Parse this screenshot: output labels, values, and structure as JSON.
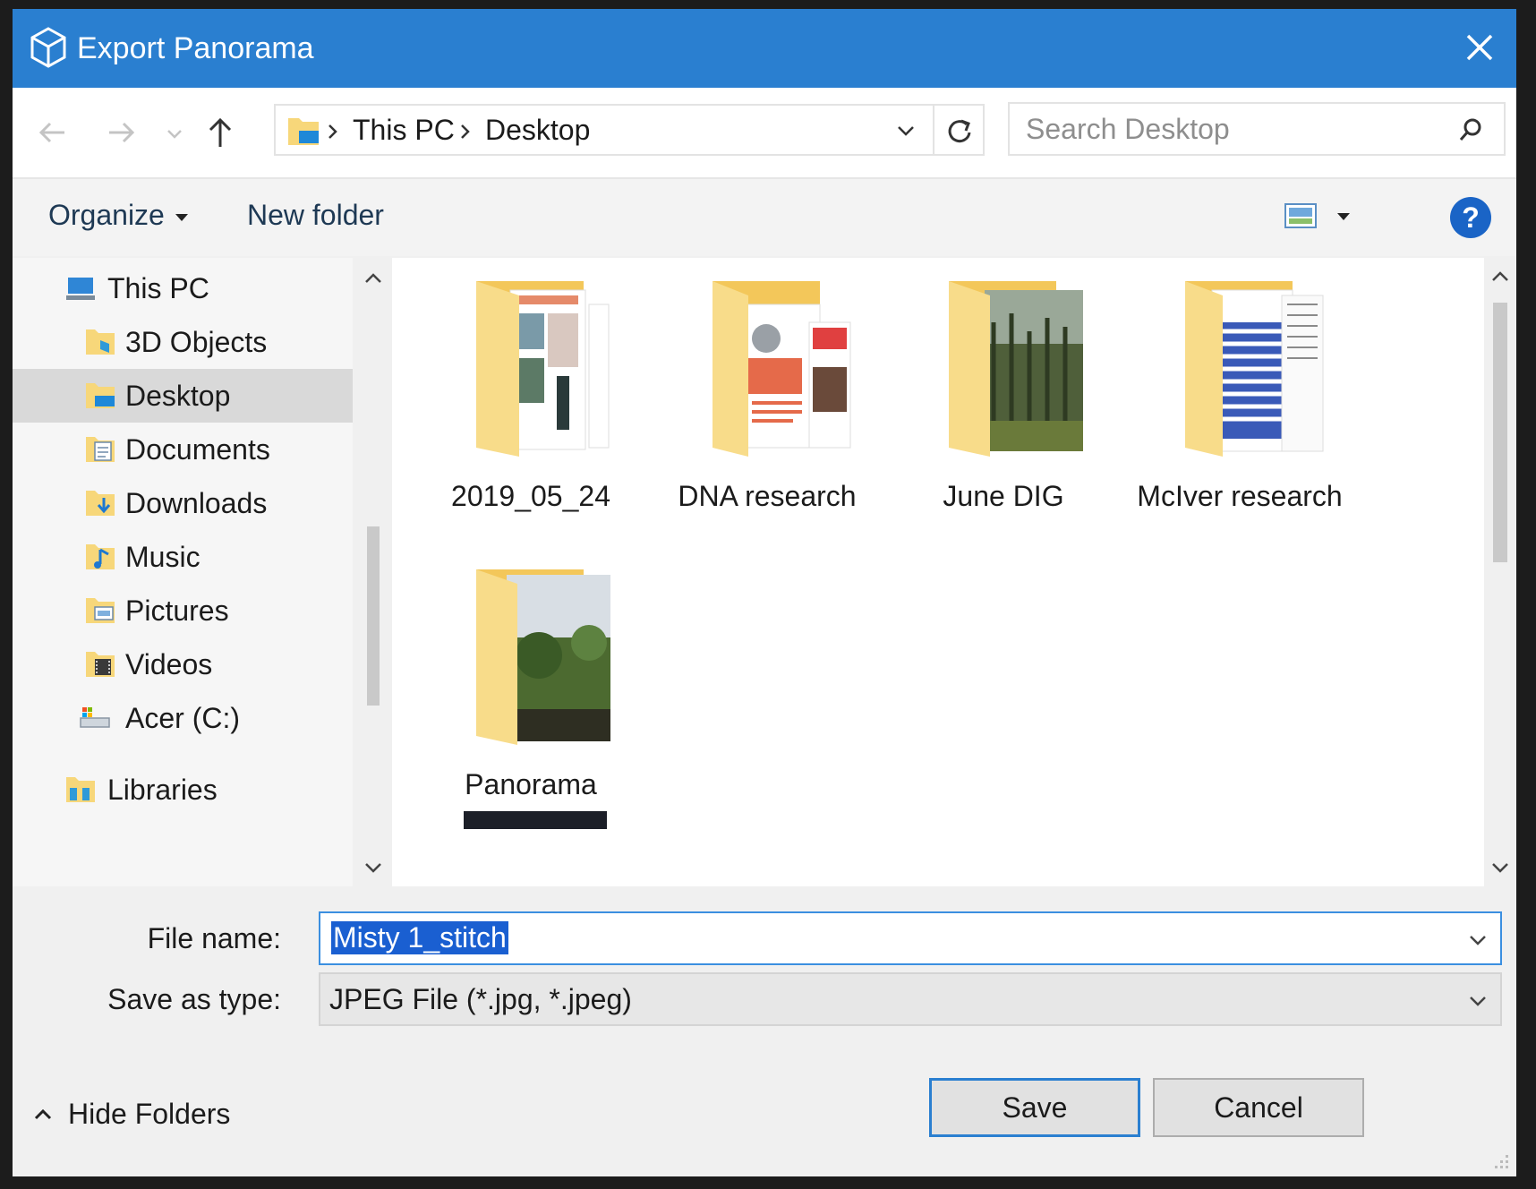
{
  "window": {
    "title": "Export Panorama"
  },
  "address": {
    "crumbs": [
      "This PC",
      "Desktop"
    ],
    "search_placeholder": "Search Desktop"
  },
  "toolbar": {
    "organize": "Organize",
    "new_folder": "New folder",
    "help": "?"
  },
  "nav": {
    "items": [
      {
        "label": "This PC",
        "icon": "pc-icon"
      },
      {
        "label": "3D Objects",
        "icon": "3d-objects-folder-icon"
      },
      {
        "label": "Desktop",
        "icon": "desktop-folder-icon",
        "selected": true
      },
      {
        "label": "Documents",
        "icon": "documents-folder-icon"
      },
      {
        "label": "Downloads",
        "icon": "downloads-folder-icon"
      },
      {
        "label": "Music",
        "icon": "music-folder-icon"
      },
      {
        "label": "Pictures",
        "icon": "pictures-folder-icon"
      },
      {
        "label": "Videos",
        "icon": "videos-folder-icon"
      },
      {
        "label": "Acer (C:)",
        "icon": "drive-icon"
      },
      {
        "label": "Libraries",
        "icon": "libraries-icon"
      }
    ]
  },
  "files": [
    {
      "name": "2019_05_24"
    },
    {
      "name": "DNA research"
    },
    {
      "name": "June DIG"
    },
    {
      "name": "McIver research"
    },
    {
      "name": "Panorama"
    }
  ],
  "form": {
    "file_name_label": "File name:",
    "file_name_value": "Misty 1_stitch",
    "save_type_label": "Save as type:",
    "save_type_value": "JPEG File (*.jpg, *.jpeg)"
  },
  "footer": {
    "hide_folders": "Hide Folders",
    "save": "Save",
    "cancel": "Cancel"
  },
  "colors": {
    "titlebar": "#2a7fd0",
    "selection": "#1a5fd1",
    "help": "#1a64c6",
    "folder": "#f7d77a"
  }
}
